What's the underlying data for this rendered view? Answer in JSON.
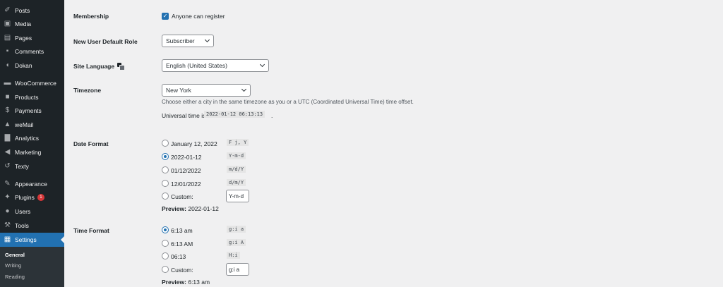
{
  "sidebar": {
    "items": [
      {
        "label": "Posts",
        "icon": "pin-icon"
      },
      {
        "label": "Media",
        "icon": "media-icon"
      },
      {
        "label": "Pages",
        "icon": "pages-icon"
      },
      {
        "label": "Comments",
        "icon": "comments-icon"
      },
      {
        "label": "Dokan",
        "icon": "dokan-icon"
      },
      {
        "label": "WooCommerce",
        "icon": "woocommerce-icon"
      },
      {
        "label": "Products",
        "icon": "products-icon"
      },
      {
        "label": "Payments",
        "icon": "payments-icon"
      },
      {
        "label": "weMail",
        "icon": "wemail-icon"
      },
      {
        "label": "Analytics",
        "icon": "analytics-icon"
      },
      {
        "label": "Marketing",
        "icon": "marketing-icon"
      },
      {
        "label": "Texty",
        "icon": "texty-icon"
      },
      {
        "label": "Appearance",
        "icon": "appearance-icon"
      },
      {
        "label": "Plugins",
        "icon": "plugins-icon",
        "badge": "1"
      },
      {
        "label": "Users",
        "icon": "users-icon"
      },
      {
        "label": "Tools",
        "icon": "tools-icon"
      },
      {
        "label": "Settings",
        "icon": "settings-icon",
        "active": true
      }
    ],
    "submenu": [
      "General",
      "Writing",
      "Reading"
    ],
    "accent_color": "#2271b1"
  },
  "settings": {
    "membership": {
      "label": "Membership",
      "checkbox_label": "Anyone can register",
      "checked": true
    },
    "default_role": {
      "label": "New User Default Role",
      "value": "Subscriber"
    },
    "site_language": {
      "label": "Site Language",
      "value": "English (United States)"
    },
    "timezone": {
      "label": "Timezone",
      "value": "New York",
      "description": "Choose either a city in the same timezone as you or a UTC (Coordinated Universal Time) time offset.",
      "universal_label": "Universal time is",
      "universal_value": "2022-01-12 06:13:13",
      "universal_suffix": "."
    },
    "date_format": {
      "label": "Date Format",
      "options": [
        {
          "label": "January 12, 2022",
          "code": "F j, Y",
          "checked": false
        },
        {
          "label": "2022-01-12",
          "code": "Y-m-d",
          "checked": true
        },
        {
          "label": "01/12/2022",
          "code": "m/d/Y",
          "checked": false
        },
        {
          "label": "12/01/2022",
          "code": "d/m/Y",
          "checked": false
        },
        {
          "label": "Custom:",
          "input": "Y-m-d",
          "checked": false
        }
      ],
      "preview_label": "Preview:",
      "preview_value": "2022-01-12"
    },
    "time_format": {
      "label": "Time Format",
      "options": [
        {
          "label": "6:13 am",
          "code": "g:i a",
          "checked": true
        },
        {
          "label": "6:13 AM",
          "code": "g:i A",
          "checked": false
        },
        {
          "label": "06:13",
          "code": "H:i",
          "checked": false
        },
        {
          "label": "Custom:",
          "input": "g:i a",
          "checked": false
        }
      ],
      "preview_label": "Preview:",
      "preview_value": "6:13 am"
    }
  }
}
